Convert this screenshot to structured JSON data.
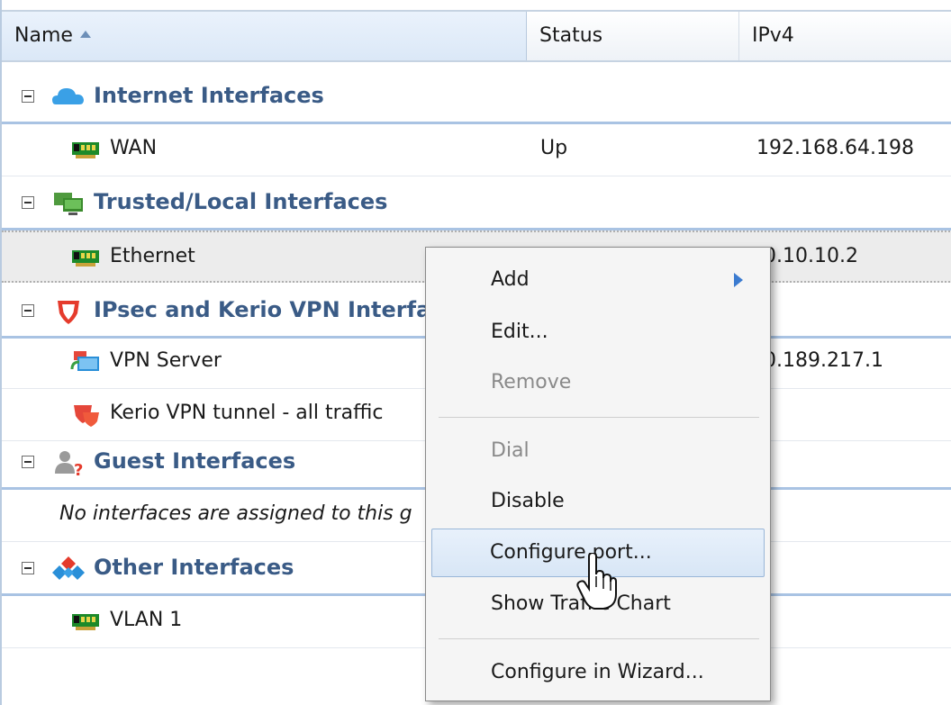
{
  "columns": {
    "name": "Name",
    "status": "Status",
    "ipv4": "IPv4"
  },
  "groups": {
    "internet": {
      "label": "Internet Interfaces",
      "icon": "cloud-icon"
    },
    "trusted": {
      "label": "Trusted/Local Interfaces",
      "icon": "computers-icon"
    },
    "vpn": {
      "label": "IPsec and Kerio VPN Interfa",
      "icon": "shield-icon"
    },
    "guest": {
      "label": "Guest Interfaces",
      "icon": "guest-user-icon"
    },
    "other": {
      "label": "Other Interfaces",
      "icon": "network-diamond-icon"
    }
  },
  "rows": {
    "wan": {
      "name": "WAN",
      "status": "Up",
      "ipv4": "192.168.64.198"
    },
    "ethernet": {
      "name": "Ethernet",
      "ipv4": "0.10.10.2"
    },
    "vpn_server": {
      "name": "VPN Server",
      "ipv4": "0.189.217.1"
    },
    "kerio_tunnel": {
      "name": "Kerio VPN tunnel - all traffic"
    },
    "guest_empty": {
      "text": "No interfaces are assigned to this g"
    },
    "vlan": {
      "name": "VLAN 1"
    }
  },
  "context_menu": {
    "add": "Add",
    "edit": "Edit...",
    "remove": "Remove",
    "dial": "Dial",
    "disable": "Disable",
    "configure_port": "Configure port...",
    "show_traffic_chart": "Show Traffic Chart",
    "configure_wizard": "Configure in Wizard..."
  },
  "colors": {
    "group_text": "#3a5b86",
    "group_border": "#a9c3e3",
    "accent": "#3b7bd0"
  }
}
